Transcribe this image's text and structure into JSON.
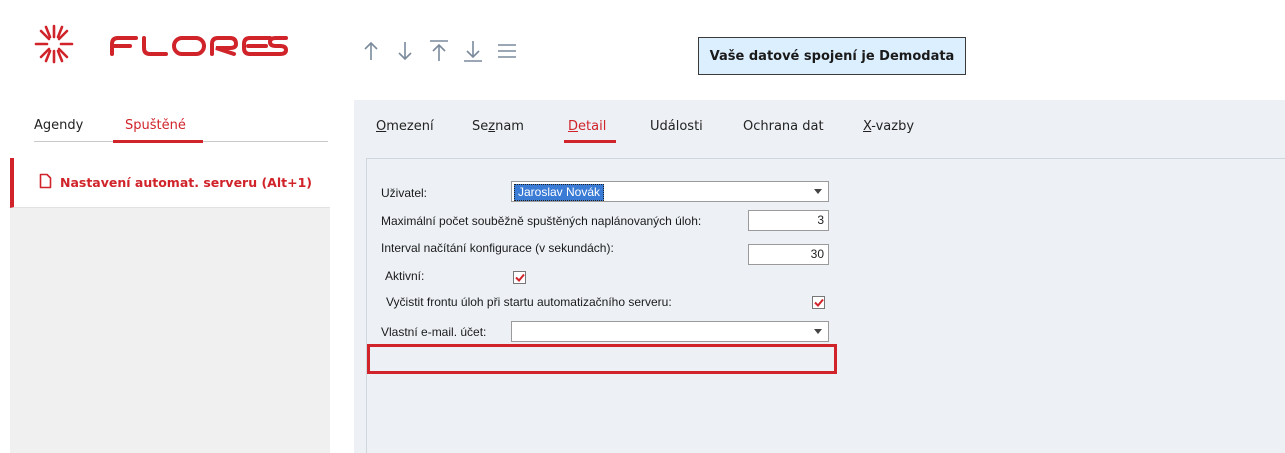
{
  "header": {
    "logo_text": "FLORES",
    "connection_banner": "Vaše datové spojení je Demodata",
    "toolbar": [
      "arrow-up-icon",
      "arrow-down-icon",
      "arrow-top-icon",
      "arrow-bottom-icon",
      "menu-icon"
    ]
  },
  "left_panel": {
    "tabs": [
      {
        "label": "Agendy",
        "active": false
      },
      {
        "label": "Spuštěné",
        "active": true
      }
    ],
    "running_items": [
      {
        "label": "Nastavení automat. serveru (Alt+1)",
        "icon": "document-icon"
      }
    ]
  },
  "main": {
    "tabs": [
      {
        "label": "Omezení",
        "mnemonic": "O",
        "rest": "mezení",
        "active": false
      },
      {
        "label": "Seznam",
        "mnemonic": "",
        "pre": "Se",
        "underlined": "z",
        "rest": "nam",
        "active": false
      },
      {
        "label": "Detail",
        "mnemonic": "D",
        "rest": "etail",
        "active": true
      },
      {
        "label": "Události",
        "active": false
      },
      {
        "label": "Ochrana dat",
        "active": false
      },
      {
        "label": "X-vazby",
        "mnemonic": "X",
        "rest": "-vazby",
        "active": false
      }
    ],
    "form": {
      "user_label": "Uživatel:",
      "user_value": "Jaroslav Novák",
      "max_jobs_label": "Maximální počet souběžně spuštěných naplánovaných úloh:",
      "max_jobs_value": "3",
      "interval_label": "Interval načítání konfigurace (v sekundách):",
      "interval_value": "30",
      "active_label": "Aktivní:",
      "active_checked": true,
      "clear_queue_label": "Vyčistit frontu úloh při startu automatizačního serveru:",
      "clear_queue_checked": true,
      "email_label": "Vlastní e-mail. účet:",
      "email_value": ""
    }
  },
  "colors": {
    "accent": "#d0232a",
    "banner_bg": "#dcefff",
    "main_bg": "#edf1f6",
    "selection": "#3a7bd5"
  }
}
